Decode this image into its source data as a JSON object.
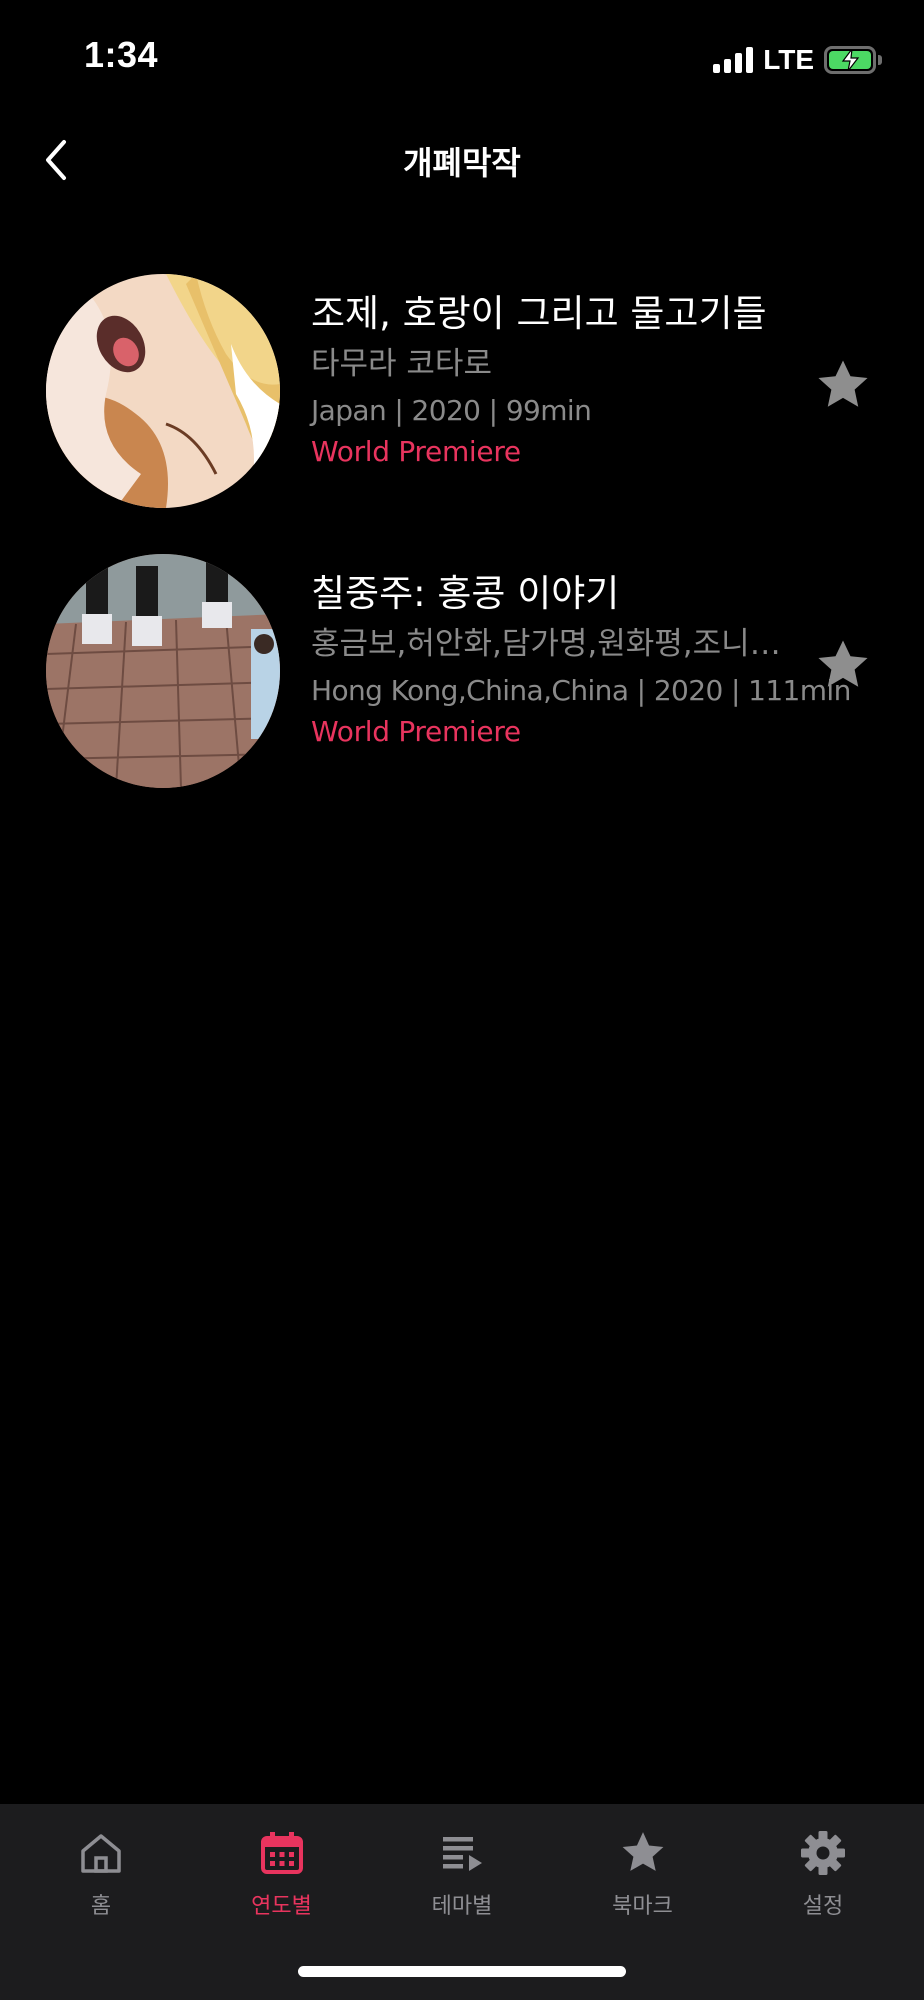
{
  "status_bar": {
    "time": "1:34",
    "network": "LTE",
    "battery_icon": "battery-charging-icon",
    "signal_icon": "cellular-signal-icon"
  },
  "header": {
    "title": "개폐막작",
    "back_icon": "chevron-left-icon"
  },
  "films": [
    {
      "title": "조제, 호랑이 그리고 물고기들",
      "director": "타무라 코타로",
      "meta": "Japan | 2020 | 99min",
      "badge": "World Premiere",
      "thumb_icon": "anime-still-thumbnail"
    },
    {
      "title": "칠중주: 홍콩 이야기",
      "director": "홍금보,허안화,담가명,원화평,조니토,서극,임영동",
      "meta": "Hong Kong,China,China | 2020 | 111min",
      "badge": "World Premiere",
      "thumb_icon": "film-still-thumbnail"
    }
  ],
  "tabs": [
    {
      "label": "홈",
      "icon": "home-icon",
      "active": false
    },
    {
      "label": "연도별",
      "icon": "calendar-icon",
      "active": true
    },
    {
      "label": "테마별",
      "icon": "playlist-icon",
      "active": false
    },
    {
      "label": "북마크",
      "icon": "star-icon",
      "active": false
    },
    {
      "label": "설정",
      "icon": "gear-icon",
      "active": false
    }
  ],
  "colors": {
    "accent": "#e8345e",
    "secondary_text": "#8a8a8a",
    "tab_bar_bg": "#1c1c1e",
    "bookmark_inactive": "#8e8e8e",
    "battery_green": "#4cd964"
  }
}
